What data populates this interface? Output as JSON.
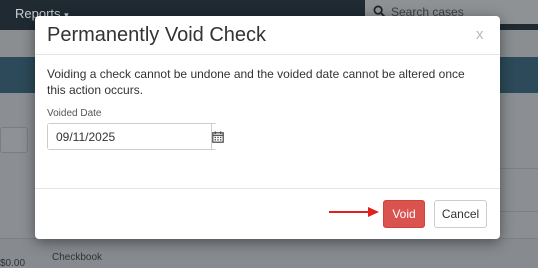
{
  "background": {
    "nav": {
      "reports_label": "Reports",
      "reports_caret": "▾"
    },
    "search": {
      "placeholder": "Search cases",
      "icon": "search-icon"
    },
    "table": {
      "checkbook_label": "Checkbook",
      "amount_fragment": "$0.00"
    }
  },
  "modal": {
    "title": "Permanently Void Check",
    "close_label": "x",
    "message": "Voiding a check cannot be undone and the voided date cannot be altered once this action occurs.",
    "voided_date": {
      "label": "Voided Date",
      "value": "09/11/2025",
      "calendar_icon": "calendar-icon"
    },
    "actions": {
      "void_label": "Void",
      "cancel_label": "Cancel",
      "annotation_arrow": "arrow-right-icon"
    }
  },
  "colors": {
    "void_button": "#d9534f",
    "annotation_arrow": "#e0201b",
    "topbar": "#1f2a33",
    "band": "#2c4a5a"
  }
}
